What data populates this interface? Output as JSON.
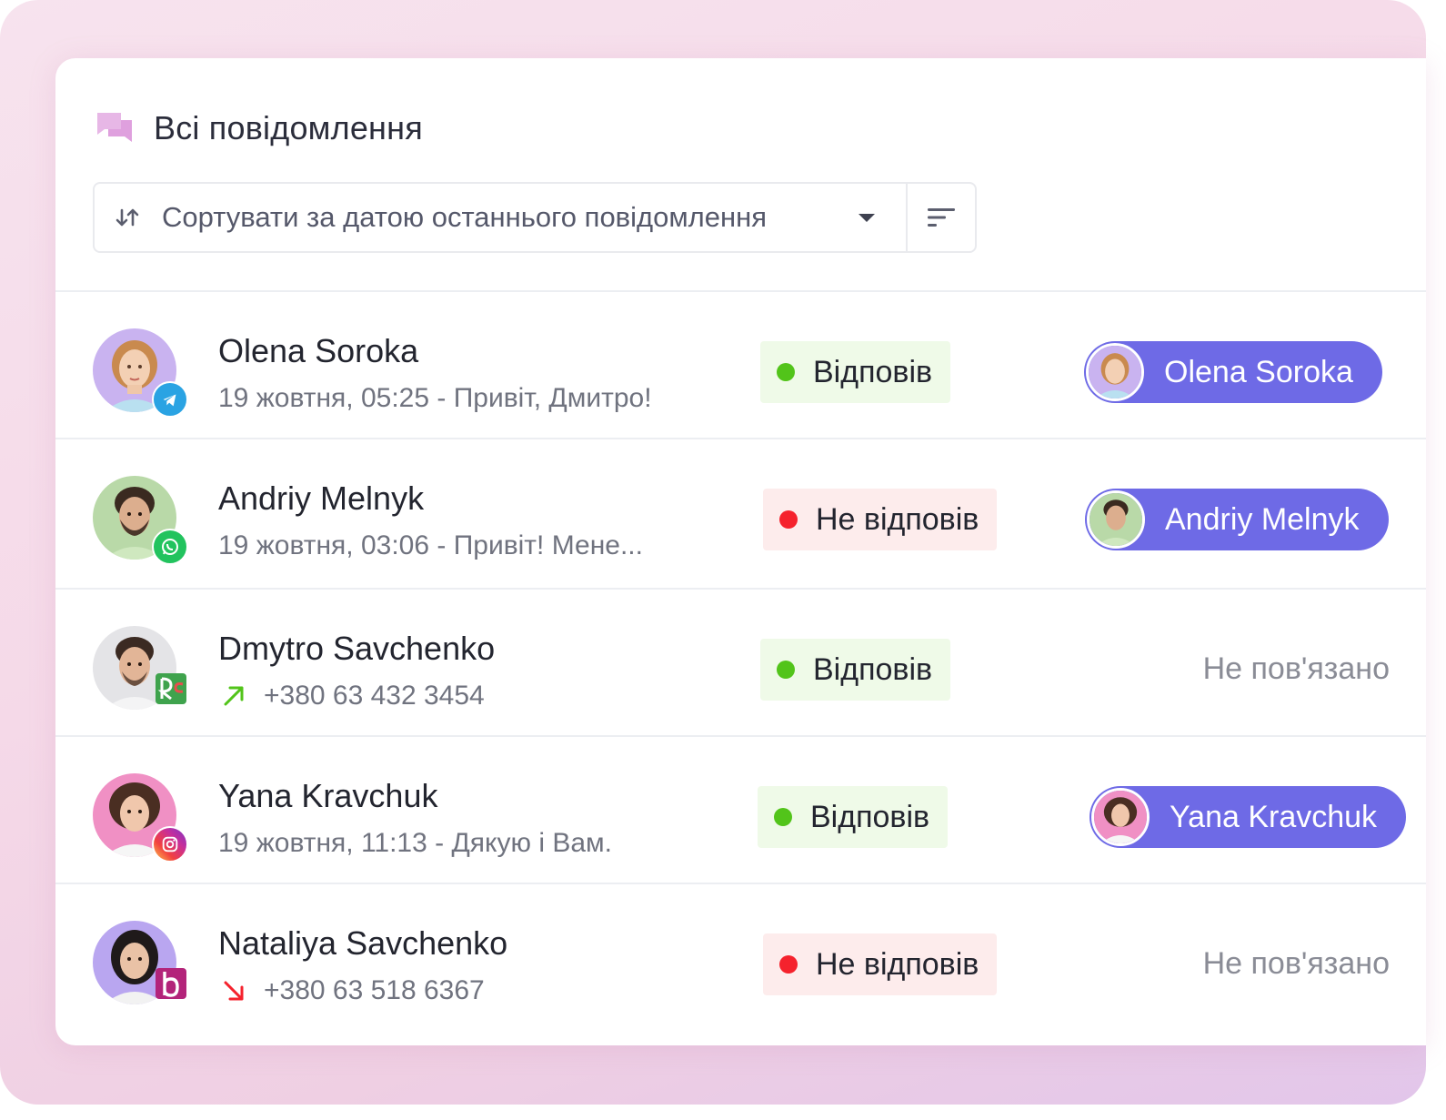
{
  "page_title": "Всі повідомлення",
  "sort": {
    "label": "Сортувати за датою останнього повідомлення"
  },
  "colors": {
    "accent": "#6e6ae6",
    "ok": "#52c41a",
    "no": "#f5222d"
  },
  "rows": [
    {
      "name": "Olena Soroka",
      "subtitle": "19 жовтня, 05:25 - Привіт, Дмитро!",
      "channel": "telegram-icon",
      "status": "Відповів",
      "status_type": "ok",
      "assignee": "Olena Soroka",
      "avatar_bg": "#c9b3f0"
    },
    {
      "name": "Andriy Melnyk",
      "subtitle": "19 жовтня, 03:06 - Привіт! Мене...",
      "channel": "whatsapp-icon",
      "status": "Не відповів",
      "status_type": "no",
      "assignee": "Andriy Melnyk",
      "avatar_bg": "#b9d9a8"
    },
    {
      "name": "Dmytro Savchenko",
      "phone": "+380 63 432 3454",
      "direction": "outgoing-call-icon",
      "channel": "ringostat-icon",
      "status": "Відповів",
      "status_type": "ok",
      "assignee_empty": "Не пов'язано",
      "avatar_bg": "#e4e4e7"
    },
    {
      "name": "Yana Kravchuk",
      "subtitle": "19 жовтня, 11:13 - Дякую і Вам.",
      "channel": "instagram-icon",
      "status": "Відповів",
      "status_type": "ok",
      "assignee": "Yana Kravchuk",
      "avatar_bg": "#f090c4"
    },
    {
      "name": "Nataliya Savchenko",
      "phone": "+380 63 518 6367",
      "direction": "incoming-call-icon",
      "channel": "binotel-icon",
      "status": "Не відповів",
      "status_type": "no",
      "assignee_empty": "Не пов'язано",
      "avatar_bg": "#b9a6f0"
    }
  ]
}
